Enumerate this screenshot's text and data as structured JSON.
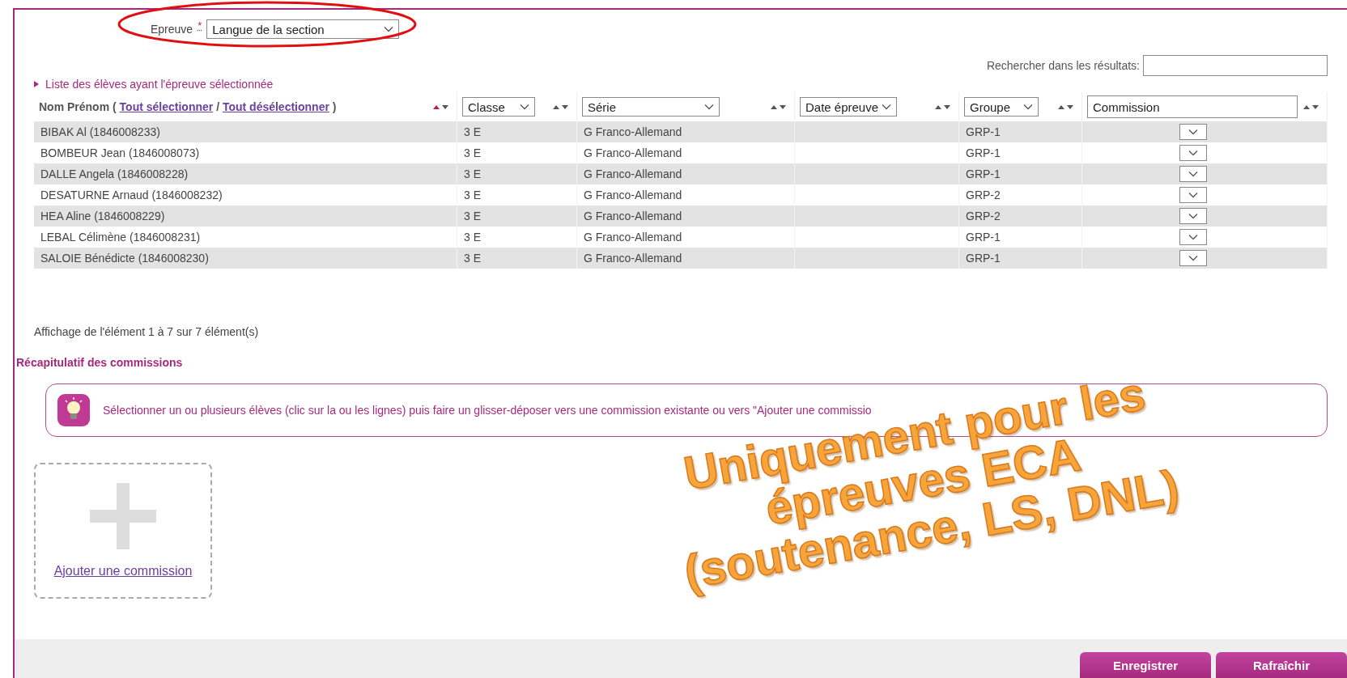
{
  "epreuve": {
    "label": "Epreuve",
    "required_mark": "*",
    "value": "Langue de la section"
  },
  "search": {
    "label": "Rechercher dans les résultats:"
  },
  "list_title": "Liste des élèves ayant l'épreuve sélectionnée",
  "table": {
    "name_header": {
      "label": "Nom Prénom (",
      "select_all": "Tout sélectionner",
      "separator": "/",
      "deselect_all": "Tout désélectionner",
      "close": ")",
      "sort_active": true
    },
    "columns": [
      {
        "kind": "select",
        "label": "Classe",
        "sort_active": false
      },
      {
        "kind": "select",
        "label": "Série",
        "sort_active": false
      },
      {
        "kind": "select",
        "label": "Date épreuve",
        "sort_active": false
      },
      {
        "kind": "select",
        "label": "Groupe",
        "sort_active": false
      },
      {
        "kind": "input",
        "label": "Commission",
        "sort_active": false
      }
    ],
    "rows": [
      {
        "name": "BIBAK Al (1846008233)",
        "classe": "3 E",
        "serie": "G Franco-Allemand",
        "date": "",
        "groupe": "GRP-1"
      },
      {
        "name": "BOMBEUR Jean (1846008073)",
        "classe": "3 E",
        "serie": "G Franco-Allemand",
        "date": "",
        "groupe": "GRP-1"
      },
      {
        "name": "DALLE Angela (1846008228)",
        "classe": "3 E",
        "serie": "G Franco-Allemand",
        "date": "",
        "groupe": "GRP-1"
      },
      {
        "name": "DESATURNE Arnaud (1846008232)",
        "classe": "3 E",
        "serie": "G Franco-Allemand",
        "date": "",
        "groupe": "GRP-2"
      },
      {
        "name": "HEA Aline (1846008229)",
        "classe": "3 E",
        "serie": "G Franco-Allemand",
        "date": "",
        "groupe": "GRP-2"
      },
      {
        "name": "LEBAL Célimène (1846008231)",
        "classe": "3 E",
        "serie": "G Franco-Allemand",
        "date": "",
        "groupe": "GRP-1"
      },
      {
        "name": "SALOIE Bénédicte (1846008230)",
        "classe": "3 E",
        "serie": "G Franco-Allemand",
        "date": "",
        "groupe": "GRP-1"
      }
    ]
  },
  "pagination_info": "Affichage de l'élément 1 à 7 sur 7 élément(s)",
  "summary_title": "Récapitulatif des commissions",
  "hint": "Sélectionner un ou plusieurs élèves (clic sur la ou les lignes) puis faire un glisser-déposer vers une commission existante ou vers \"Ajouter une commissio",
  "add_commission": "Ajouter une commission",
  "overlay_note": [
    "Uniquement pour les",
    "épreuves ECA",
    "(soutenance, LS, DNL)"
  ],
  "buttons": [
    "Enregistrer",
    "Rafraîchir"
  ]
}
